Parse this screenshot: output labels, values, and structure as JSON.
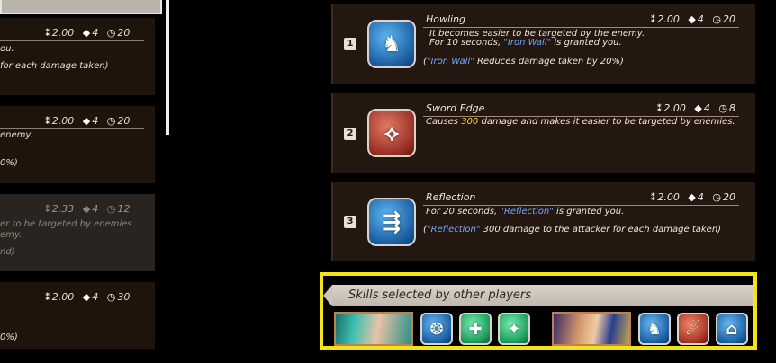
{
  "left": {
    "cards": [
      {
        "stats": {
          "ct": "2.00",
          "cost": "4",
          "cd": "20"
        },
        "lines": [
          "ou.",
          "for each damage taken)"
        ]
      },
      {
        "stats": {
          "ct": "2.00",
          "cost": "4",
          "cd": "20"
        },
        "lines": [
          "enemy.",
          "0%)"
        ]
      },
      {
        "stats": {
          "ct": "2.33",
          "cost": "4",
          "cd": "12"
        },
        "lines": [
          "er to be targeted by enemies.",
          "emy.",
          "nd)"
        ]
      },
      {
        "stats": {
          "ct": "2.00",
          "cost": "4",
          "cd": "30"
        },
        "lines": [
          "0%)"
        ]
      }
    ]
  },
  "skills": [
    {
      "number": "1",
      "name": "Howling",
      "stats": {
        "ct": "2.00",
        "cost": "4",
        "cd": "20"
      },
      "line1": "It becomes easier to be targeted by the enemy.",
      "line2_pre": "For 10 seconds, ",
      "line2_hl": "\"Iron Wall\"",
      "line2_post": " is granted you.",
      "note_open": "(",
      "note_hl": "\"Iron Wall\"",
      "note_post": " Reduces damage taken by 20%)"
    },
    {
      "number": "2",
      "name": "Sword Edge",
      "stats": {
        "ct": "2.00",
        "cost": "4",
        "cd": "8"
      },
      "line1_pre": "Causes ",
      "line1_hl": "300",
      "line1_post": " damage and makes it easier to be targeted by enemies."
    },
    {
      "number": "3",
      "name": "Reflection",
      "stats": {
        "ct": "2.00",
        "cost": "4",
        "cd": "20"
      },
      "line1_pre": "For 20 seconds, ",
      "line1_hl": "\"Reflection\"",
      "line1_post": " is granted you.",
      "note_open": "(",
      "note_hl": "\"Reflection\"",
      "note_post": " 300 damage to the attacker for each damage taken)"
    }
  ],
  "panel": {
    "title": "Skills selected by other players",
    "players": [
      {
        "skills": [
          {
            "color": "blue",
            "icon": "heart-shield-icon"
          },
          {
            "color": "green",
            "icon": "heal-drop-icon"
          },
          {
            "color": "green",
            "icon": "sparkle-grid-icon"
          }
        ]
      },
      {
        "skills": [
          {
            "color": "blue",
            "icon": "howl-icon"
          },
          {
            "color": "red",
            "icon": "comet-icon"
          },
          {
            "color": "blue",
            "icon": "dome-shield-icon"
          }
        ]
      }
    ]
  },
  "colors": {
    "highlight": "#f4e21a",
    "accent_blue": "#6fa6ff",
    "accent_yellow": "#ffd23a",
    "card_bg": "#231710"
  }
}
